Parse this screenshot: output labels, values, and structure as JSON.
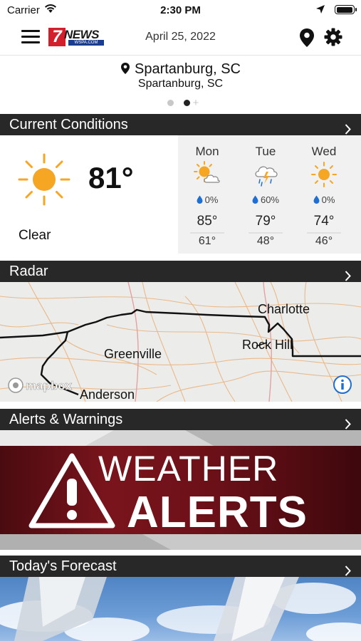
{
  "status_bar": {
    "carrier": "Carrier",
    "time": "2:30 PM"
  },
  "header": {
    "date": "April 25, 2022",
    "logo_number": "7",
    "logo_text": "NEWS",
    "logo_sub": "WSPA.COM"
  },
  "location": {
    "city": "Spartanburg, SC",
    "subtitle": "Spartanburg, SC",
    "page_index": 1,
    "page_count": 2
  },
  "sections": {
    "current_conditions": "Current Conditions",
    "radar": "Radar",
    "alerts": "Alerts & Warnings",
    "today_forecast": "Today's Forecast"
  },
  "current": {
    "temperature": "81°",
    "condition": "Clear",
    "icon": "sun-icon"
  },
  "forecast": [
    {
      "day": "Mon",
      "icon": "partly-cloudy-icon",
      "precip": "0%",
      "high": "85°",
      "low": "61°"
    },
    {
      "day": "Tue",
      "icon": "thunderstorm-icon",
      "precip": "60%",
      "high": "79°",
      "low": "48°"
    },
    {
      "day": "Wed",
      "icon": "sun-icon",
      "precip": "0%",
      "high": "74°",
      "low": "46°"
    }
  ],
  "radar_map": {
    "cities": [
      "Charlotte",
      "Rock Hill",
      "Greenville",
      "Anderson"
    ],
    "attribution": "mapbox"
  },
  "alerts_banner": {
    "line1": "WEATHER",
    "line2": "ALERTS"
  },
  "colors": {
    "bar": "#282828",
    "sun": "#f5a623",
    "drop": "#1f6fd1",
    "alert_red": "#7a141c"
  }
}
